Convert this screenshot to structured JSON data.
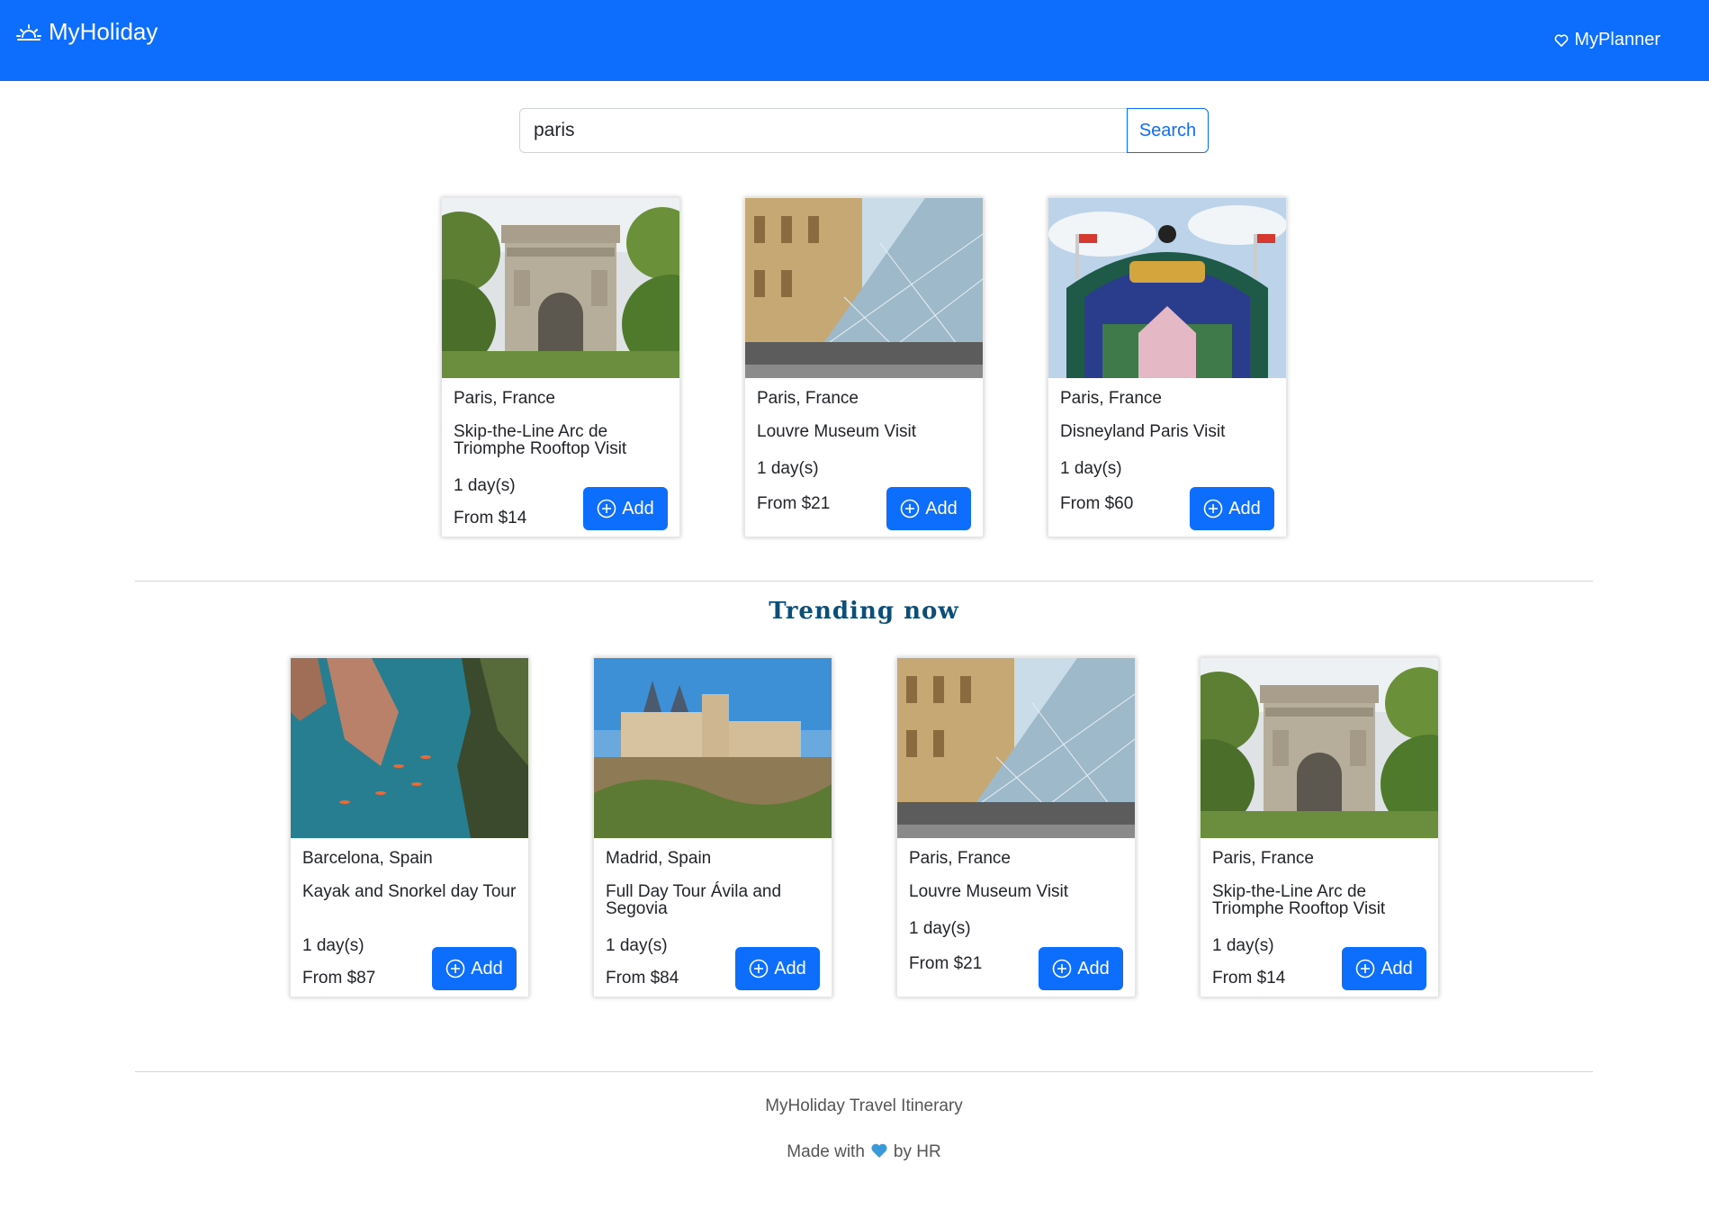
{
  "navbar": {
    "brand": "MyHoliday",
    "planner_label": "MyPlanner",
    "color": "#0d6efd"
  },
  "search": {
    "value": "paris",
    "button_label": "Search"
  },
  "results": [
    {
      "location": "Paris, France",
      "title": "Skip-the-Line Arc de Triomphe Rooftop Visit",
      "duration": "1 day(s)",
      "price": "From $14",
      "image": "arc-de-triomphe",
      "add_label": "Add"
    },
    {
      "location": "Paris, France",
      "title": "Louvre Museum Visit",
      "duration": "1 day(s)",
      "price": "From $21",
      "image": "louvre",
      "add_label": "Add"
    },
    {
      "location": "Paris, France",
      "title": "Disneyland Paris Visit",
      "duration": "1 day(s)",
      "price": "From $60",
      "image": "disneyland",
      "add_label": "Add"
    }
  ],
  "trending": {
    "heading": "Trending now",
    "items": [
      {
        "location": "Barcelona, Spain",
        "title": "Kayak and Snorkel day Tour",
        "duration": "1 day(s)",
        "price": "From $87",
        "image": "kayak-coast",
        "add_label": "Add"
      },
      {
        "location": "Madrid, Spain",
        "title": "Full Day Tour Ávila and Segovia",
        "duration": "1 day(s)",
        "price": "From $84",
        "image": "segovia-castle",
        "add_label": "Add"
      },
      {
        "location": "Paris, France",
        "title": "Louvre Museum Visit",
        "duration": "1 day(s)",
        "price": "From $21",
        "image": "louvre",
        "add_label": "Add"
      },
      {
        "location": "Paris, France",
        "title": "Skip-the-Line Arc de Triomphe Rooftop Visit",
        "duration": "1 day(s)",
        "price": "From $14",
        "image": "arc-de-triomphe",
        "add_label": "Add"
      }
    ]
  },
  "footer": {
    "line1": "MyHoliday Travel Itinerary",
    "made_with": "Made with",
    "by": "by HR"
  }
}
